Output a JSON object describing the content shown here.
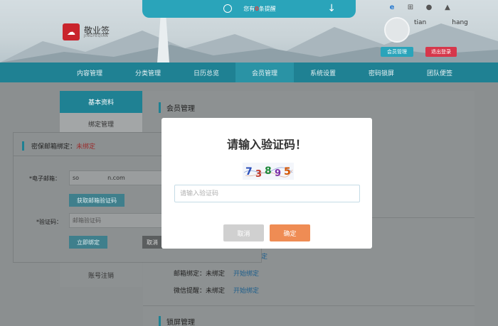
{
  "header": {
    "notify_prefix": "您有",
    "notify_count": "0",
    "notify_suffix": "条提醒",
    "brand_cn": "敬业签",
    "brand_en": "JINGYEQIAN",
    "username": "tian    hang",
    "member_btn": "会员管理",
    "logout_btn": "退出登录",
    "os_icons": [
      "ie-icon",
      "windows-icon",
      "apple-icon",
      "android-icon"
    ]
  },
  "nav": {
    "items": [
      "内容管理",
      "分类管理",
      "日历总览",
      "会员管理",
      "系统设置",
      "密码锁屏",
      "团队便签"
    ],
    "active": "会员管理"
  },
  "side": {
    "items": [
      "基本资料",
      "绑定管理"
    ],
    "bottom_item": "账号注销"
  },
  "main": {
    "section1_title": "会员管理",
    "section2_title": "锁屏管理",
    "link_fragment": "定",
    "email_label": "邮箱绑定：",
    "email_status": "未绑定",
    "email_link": "开始绑定",
    "wechat_label": "微信提醒：",
    "wechat_status": "未绑定",
    "wechat_link": "开始绑定"
  },
  "bind_popup": {
    "title": "密保邮箱绑定：",
    "status": "未绑定",
    "email_label": "*电子邮箱：",
    "email_value": "so     n.com",
    "get_code_btn": "获取邮箱验证码",
    "code_label": "*验证码：",
    "code_placeholder": "邮箱验证码",
    "bind_btn": "立即绑定",
    "cancel_btn": "取消"
  },
  "modal": {
    "title": "请输入验证码！",
    "captcha_digits": [
      "7",
      "3",
      "8",
      "9",
      "5"
    ],
    "captcha_colors": [
      "#2b4fb8",
      "#c0392b",
      "#1e8a3a",
      "#7b2fa8",
      "#d35400"
    ],
    "input_value": "",
    "input_placeholder": "请输入验证码",
    "cancel_label": "取消",
    "confirm_label": "确定"
  }
}
